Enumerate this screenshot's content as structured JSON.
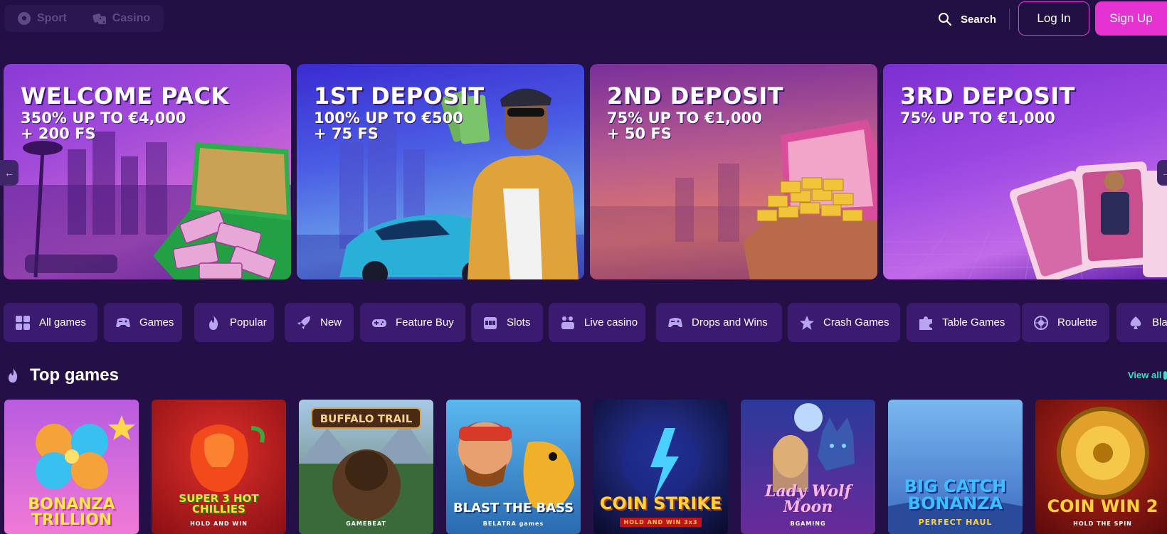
{
  "header": {
    "modes": [
      {
        "label": "Sport",
        "icon": "soccer-ball-icon"
      },
      {
        "label": "Casino",
        "icon": "dice-icon"
      }
    ],
    "search_label": "Search",
    "login_label": "Log In",
    "signup_label": "Sign Up"
  },
  "banners": [
    {
      "title": "WELCOME PACK",
      "line1": "350% UP TO €4,000",
      "line2": "+ 200 FS"
    },
    {
      "title": "1ST DEPOSIT",
      "line1": "100% UP TO €500",
      "line2": "+ 75 FS"
    },
    {
      "title": "2ND DEPOSIT",
      "line1": "75% UP TO €1,000",
      "line2": "+ 50 FS"
    },
    {
      "title": "3RD DEPOSIT",
      "line1": "75% UP TO €1,000",
      "line2": ""
    }
  ],
  "categories": [
    {
      "label": "All games",
      "icon": "grid-icon"
    },
    {
      "label": "Games",
      "icon": "gamepad-icon"
    },
    {
      "label": "Popular",
      "icon": "flame-icon"
    },
    {
      "label": "New",
      "icon": "rocket-icon"
    },
    {
      "label": "Feature Buy",
      "icon": "controller-icon"
    },
    {
      "label": "Slots",
      "icon": "slot-machine-icon"
    },
    {
      "label": "Live casino",
      "icon": "live-dealer-icon"
    },
    {
      "label": "Drops and Wins",
      "icon": "drops-icon"
    },
    {
      "label": "Crash Games",
      "icon": "star-icon"
    },
    {
      "label": "Table Games",
      "icon": "puzzle-icon"
    },
    {
      "label": "Roulette",
      "icon": "roulette-icon"
    },
    {
      "label": "Bla",
      "icon": "spade-icon"
    }
  ],
  "top_games": {
    "title": "Top games",
    "view_all": "View all",
    "games": [
      {
        "name": "BONANZA TRILLION",
        "sub": ""
      },
      {
        "name": "SUPER 3 HOT CHILLIES",
        "sub": "HOLD AND WIN"
      },
      {
        "name": "BUFFALO TRAIL",
        "sub": "GAMEBEAT"
      },
      {
        "name": "BLAST THE BASS",
        "sub": "BELATRA games"
      },
      {
        "name": "COIN STRIKE",
        "sub": "HOLD AND WIN 3x3"
      },
      {
        "name": "Lady Wolf Moon",
        "sub": "BGAMING"
      },
      {
        "name": "BIG CATCH BONANZA",
        "sub": "PERFECT HAUL"
      },
      {
        "name": "COIN WIN 2",
        "sub": "HOLD THE SPIN"
      }
    ]
  },
  "colors": {
    "background": "#241046",
    "accent": "#e632d3",
    "category_bg": "#3a1b70",
    "view_all": "#37e3b8"
  }
}
